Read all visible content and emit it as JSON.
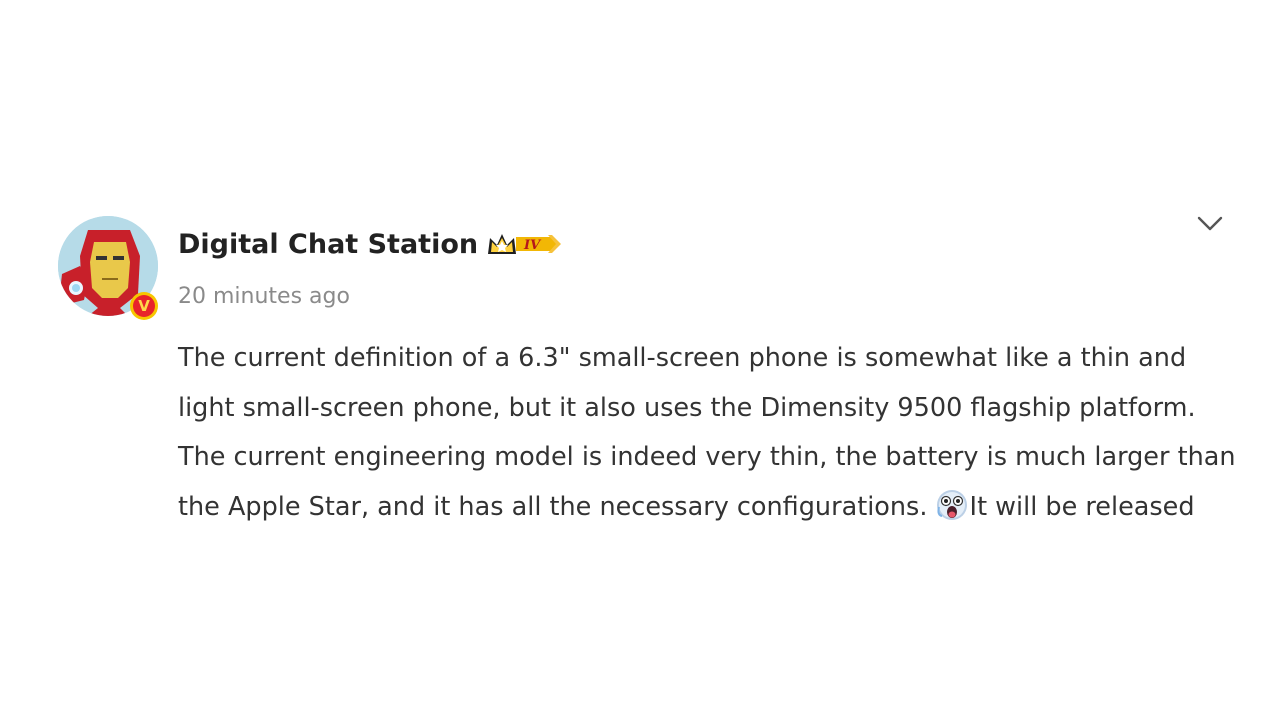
{
  "post": {
    "author": {
      "name": "Digital Chat Station",
      "level_badge": "IV",
      "verified_mark": "V"
    },
    "timestamp": "20 minutes ago",
    "body_lines": [
      "The current definition of a 6.3\" small-screen phone is somewhat like a thin and",
      "light small-screen phone, but it also uses the Dimensity 9500 flagship platform.",
      "The current engineering model is indeed very thin, the battery is much larger than",
      "the Apple Star, and it has all the necessary configurations."
    ],
    "body_tail_after_emoji": "It will be released",
    "icons": {
      "avatar": "iron-man-avatar",
      "verified": "verified-badge-icon",
      "level": "crown-level-badge-icon",
      "emoji": "shocked-emoji-icon",
      "menu": "chevron-down-icon"
    },
    "colors": {
      "username": "#222222",
      "timestamp": "#8a8a8a",
      "body": "#333333",
      "badge_gold": "#f7c600",
      "badge_red": "#e8232b"
    }
  }
}
